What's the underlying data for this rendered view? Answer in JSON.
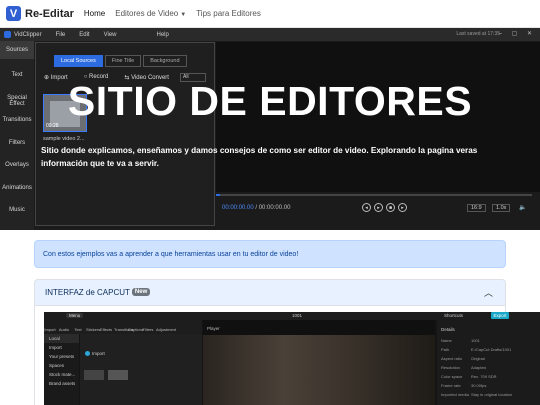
{
  "nav": {
    "logo_letter": "V",
    "brand": "Re-Editar",
    "links": [
      "Home",
      "Editores de Video",
      "Tips para Editores"
    ]
  },
  "hero": {
    "title": "SITIO DE EDITORES",
    "subtitle": "Sitio donde explicamos, enseñamos y damos consejos de como ser editor de video. Explorando la pagina veras información que te va a servir.",
    "editor": {
      "app_name": "VidClipper",
      "menu": [
        "File",
        "Edit",
        "View",
        "Help"
      ],
      "saved": "Last saved at 17:35",
      "left_nav": [
        "Sources",
        "Text",
        "Special Effect",
        "Transitions",
        "Filters",
        "Overlays",
        "Animations",
        "Music"
      ],
      "tabs": [
        "Local Sources",
        "Fine Title",
        "Background"
      ],
      "tools": [
        "Import",
        "Record",
        "Video Convert"
      ],
      "filter": "All",
      "thumb_time": "00:28",
      "thumb_caption": "sample video 2...",
      "time_current": "00:00:00.00",
      "time_total": "/ 00:00:00.00",
      "ratio": "16:9",
      "speed": "1.0x"
    }
  },
  "alert": {
    "text": "Con estos ejemplos vas a aprender a que herramientas usar en tu editor de video!"
  },
  "accordion": {
    "title": "INTERFAZ de CAPCUT",
    "badge": "New"
  },
  "capcut": {
    "menu": "Menu",
    "title": "1001",
    "shortcuts": "Shortcuts",
    "export": "Export",
    "tools": [
      "Import",
      "Audio",
      "Text",
      "Stickers",
      "Effects",
      "Transitions",
      "Captions",
      "Filters",
      "Adjustment"
    ],
    "side": [
      "Local",
      "Import",
      "Your presets",
      "Spaces",
      "Stock mate...",
      "Brand assets"
    ],
    "import_label": "Import",
    "player_label": "Player",
    "details_title": "Details",
    "details": [
      {
        "k": "Name",
        "v": "1001"
      },
      {
        "k": "Path",
        "v": "E:/CapCut Drafts/1001"
      },
      {
        "k": "Aspect ratio",
        "v": "Original"
      },
      {
        "k": "Resolution",
        "v": "Adapted"
      },
      {
        "k": "Color space",
        "v": "Rec. 709 SDR"
      },
      {
        "k": "Frame rate",
        "v": "30.00fps"
      },
      {
        "k": "Imported media",
        "v": "Stay in original location"
      }
    ]
  }
}
